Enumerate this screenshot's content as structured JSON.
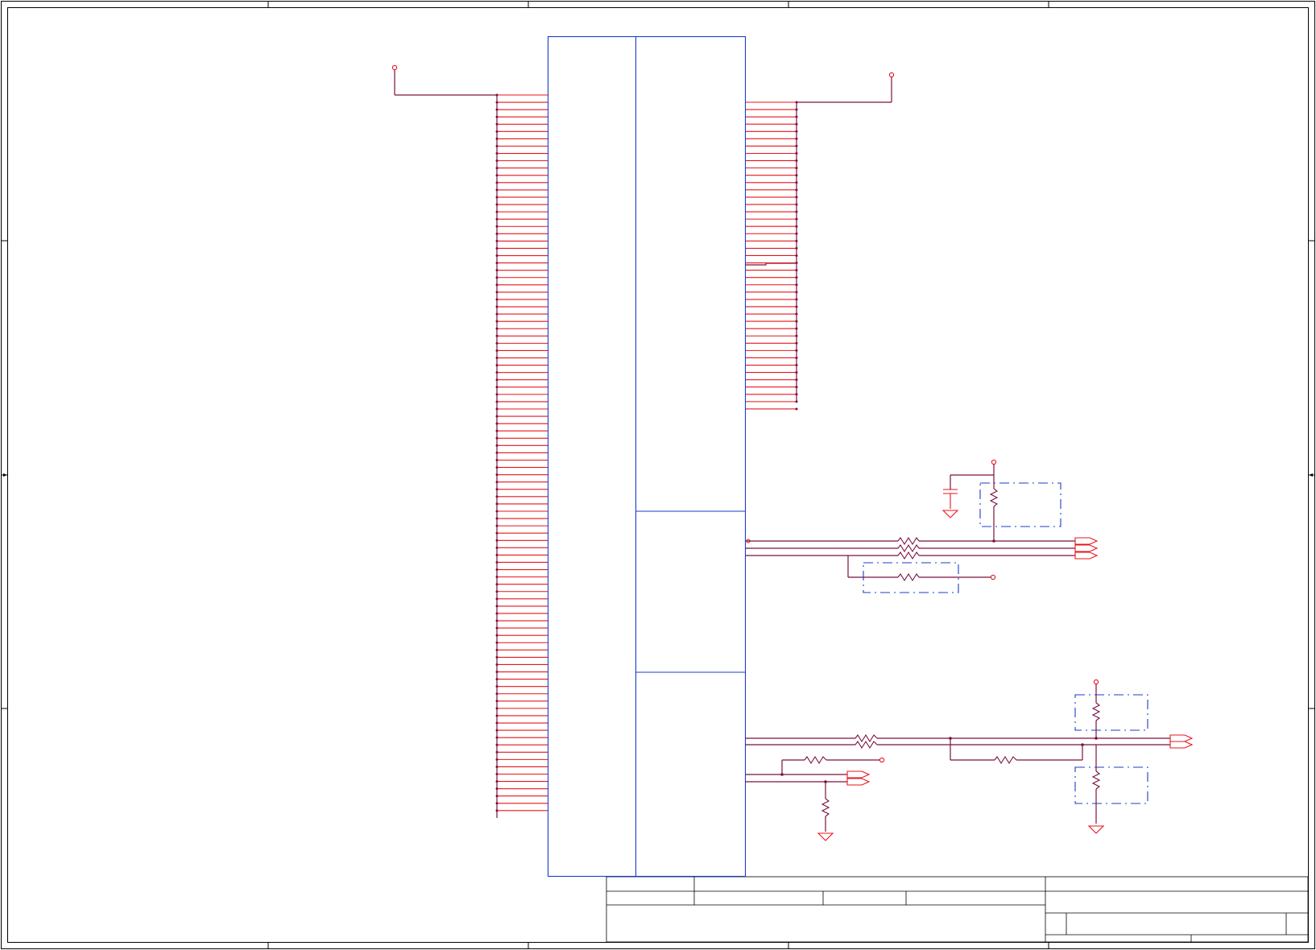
{
  "diagram": {
    "kind": "schematic sheet",
    "text_labels": [],
    "colors": {
      "border": "#000000",
      "component_outline": "#1a3cc8",
      "net_wire": "#7a1040",
      "pin_and_power": "#e8141b",
      "background": "#ffffff"
    },
    "connector": {
      "left_bus_pin_count": 99,
      "right_bus_pin_count": 43
    },
    "symbols": [
      "power-port",
      "ground-symbol",
      "resistor",
      "capacitor",
      "net-port-arrow"
    ]
  }
}
